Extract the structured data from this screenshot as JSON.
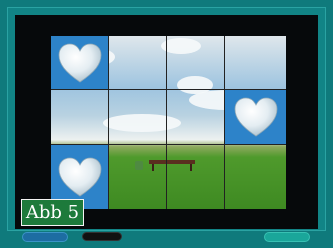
{
  "badge": {
    "label": "Abb 5"
  },
  "controls": {
    "left_button_label": "",
    "counter_a": "",
    "counter_b": "",
    "right_button_label": ""
  },
  "board": {
    "rows": 3,
    "cols": 4,
    "revealed_cells": [
      {
        "row": 0,
        "col": 0,
        "icon": "stone-heart-icon"
      },
      {
        "row": 1,
        "col": 3,
        "icon": "stone-heart-icon"
      },
      {
        "row": 2,
        "col": 0,
        "icon": "stone-heart-icon"
      }
    ]
  },
  "colors": {
    "background_teal": "#0f7a7c",
    "card_blue": "#2d83c9",
    "badge_green": "#1d7a3b"
  }
}
